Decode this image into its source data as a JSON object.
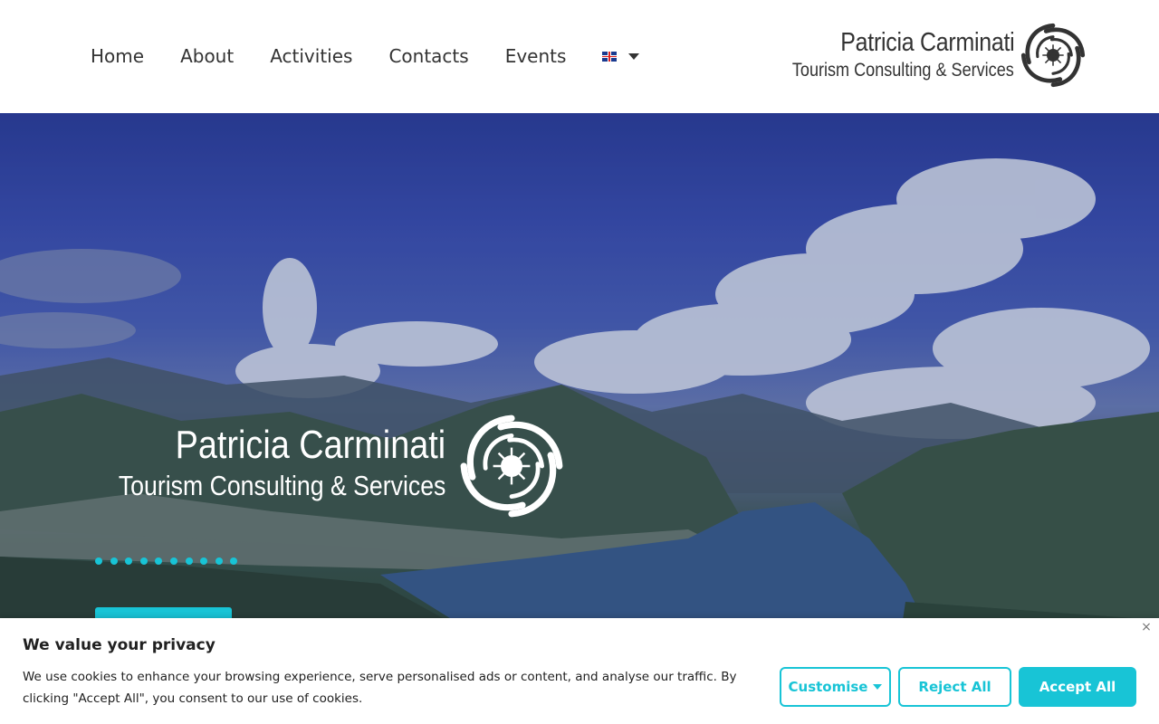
{
  "nav": {
    "items": [
      {
        "label": "Home"
      },
      {
        "label": "About"
      },
      {
        "label": "Activities"
      },
      {
        "label": "Contacts"
      },
      {
        "label": "Events"
      }
    ],
    "language_icon": "uk-flag-icon"
  },
  "logo": {
    "name": "Patricia Carminati",
    "tagline": "Tourism Consulting & Services",
    "icon": "spiral-sun-icon"
  },
  "hero": {
    "name": "Patricia Carminati",
    "tagline": "Tourism Consulting & Services",
    "dot_count": 10,
    "accent_color": "#18c4d6"
  },
  "cookie": {
    "title": "We value your privacy",
    "text": "We use cookies to enhance your browsing experience, serve personalised ads or content, and analyse our traffic. By clicking \"Accept All\", you consent to our use of cookies.",
    "close_symbol": "×",
    "customise_label": "Customise",
    "reject_label": "Reject All",
    "accept_label": "Accept All"
  }
}
